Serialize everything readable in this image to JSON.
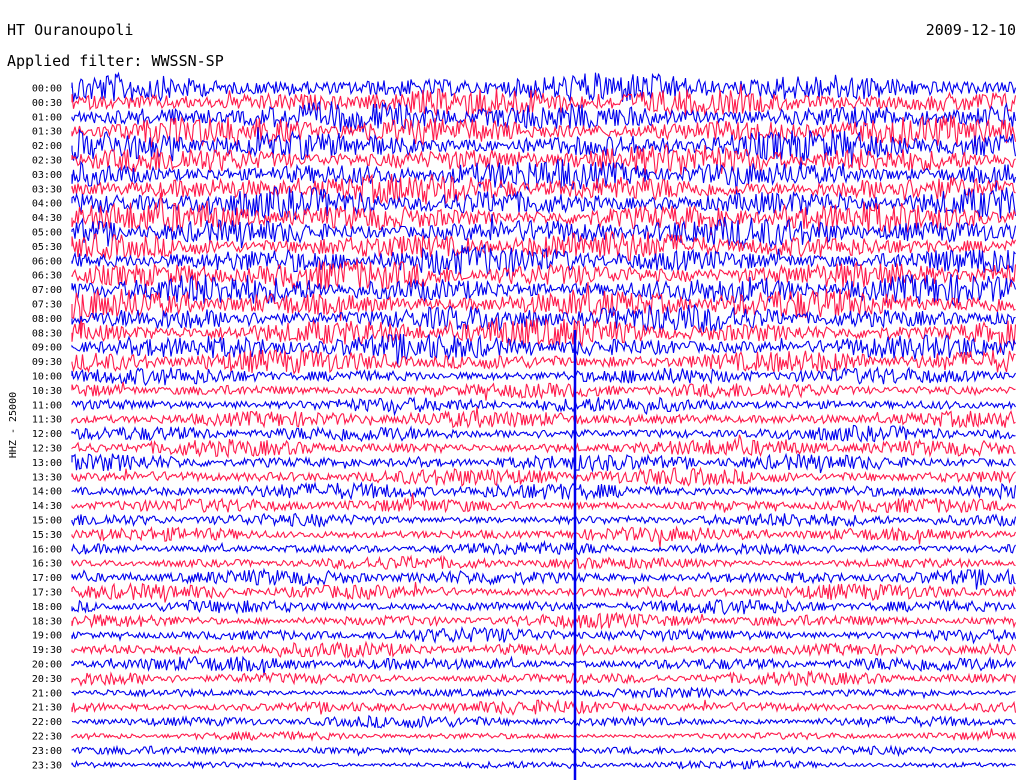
{
  "header": {
    "station": "HT Ouranoupoli",
    "filter": "Applied filter: WWSSN-SP",
    "date": "2009-12-10"
  },
  "chart_data": {
    "type": "line",
    "ylabel": "HHZ - 25000",
    "rows": [
      {
        "label": "00:00",
        "color": "#0000ee",
        "activity": 0.95
      },
      {
        "label": "00:30",
        "color": "#ff1a4b",
        "activity": 0.95
      },
      {
        "label": "01:00",
        "color": "#0000ee",
        "activity": 0.95
      },
      {
        "label": "01:30",
        "color": "#ff1a4b",
        "activity": 0.95
      },
      {
        "label": "02:00",
        "color": "#0000ee",
        "activity": 0.95
      },
      {
        "label": "02:30",
        "color": "#ff1a4b",
        "activity": 0.95
      },
      {
        "label": "03:00",
        "color": "#0000ee",
        "activity": 0.95
      },
      {
        "label": "03:30",
        "color": "#ff1a4b",
        "activity": 0.95
      },
      {
        "label": "04:00",
        "color": "#0000ee",
        "activity": 0.95
      },
      {
        "label": "04:30",
        "color": "#ff1a4b",
        "activity": 0.95
      },
      {
        "label": "05:00",
        "color": "#0000ee",
        "activity": 0.95
      },
      {
        "label": "05:30",
        "color": "#ff1a4b",
        "activity": 0.95
      },
      {
        "label": "06:00",
        "color": "#0000ee",
        "activity": 0.95
      },
      {
        "label": "06:30",
        "color": "#ff1a4b",
        "activity": 0.95
      },
      {
        "label": "07:00",
        "color": "#0000ee",
        "activity": 0.95
      },
      {
        "label": "07:30",
        "color": "#ff1a4b",
        "activity": 0.95
      },
      {
        "label": "08:00",
        "color": "#0000ee",
        "activity": 0.9
      },
      {
        "label": "08:30",
        "color": "#ff1a4b",
        "activity": 0.9
      },
      {
        "label": "09:00",
        "color": "#0000ee",
        "activity": 0.8
      },
      {
        "label": "09:30",
        "color": "#ff1a4b",
        "activity": 0.7
      },
      {
        "label": "10:00",
        "color": "#0000ee",
        "activity": 0.45
      },
      {
        "label": "10:30",
        "color": "#ff1a4b",
        "activity": 0.4
      },
      {
        "label": "11:00",
        "color": "#0000ee",
        "activity": 0.4
      },
      {
        "label": "11:30",
        "color": "#ff1a4b",
        "activity": 0.45
      },
      {
        "label": "12:00",
        "color": "#0000ee",
        "activity": 0.4
      },
      {
        "label": "12:30",
        "color": "#ff1a4b",
        "activity": 0.45
      },
      {
        "label": "13:00",
        "color": "#0000ee",
        "activity": 0.45
      },
      {
        "label": "13:30",
        "color": "#ff1a4b",
        "activity": 0.5
      },
      {
        "label": "14:00",
        "color": "#0000ee",
        "activity": 0.45
      },
      {
        "label": "14:30",
        "color": "#ff1a4b",
        "activity": 0.35
      },
      {
        "label": "15:00",
        "color": "#0000ee",
        "activity": 0.3
      },
      {
        "label": "15:30",
        "color": "#ff1a4b",
        "activity": 0.35
      },
      {
        "label": "16:00",
        "color": "#0000ee",
        "activity": 0.3
      },
      {
        "label": "16:30",
        "color": "#ff1a4b",
        "activity": 0.3
      },
      {
        "label": "17:00",
        "color": "#0000ee",
        "activity": 0.4
      },
      {
        "label": "17:30",
        "color": "#ff1a4b",
        "activity": 0.4
      },
      {
        "label": "18:00",
        "color": "#0000ee",
        "activity": 0.35
      },
      {
        "label": "18:30",
        "color": "#ff1a4b",
        "activity": 0.35
      },
      {
        "label": "19:00",
        "color": "#0000ee",
        "activity": 0.35
      },
      {
        "label": "19:30",
        "color": "#ff1a4b",
        "activity": 0.35
      },
      {
        "label": "20:00",
        "color": "#0000ee",
        "activity": 0.35
      },
      {
        "label": "20:30",
        "color": "#ff1a4b",
        "activity": 0.3
      },
      {
        "label": "21:00",
        "color": "#0000ee",
        "activity": 0.15
      },
      {
        "label": "21:30",
        "color": "#ff1a4b",
        "activity": 0.3
      },
      {
        "label": "22:00",
        "color": "#0000ee",
        "activity": 0.25
      },
      {
        "label": "22:30",
        "color": "#ff1a4b",
        "activity": 0.1
      },
      {
        "label": "23:00",
        "color": "#0000ee",
        "activity": 0.1
      },
      {
        "label": "23:30",
        "color": "#0000ee",
        "activity": 0.1
      }
    ]
  }
}
